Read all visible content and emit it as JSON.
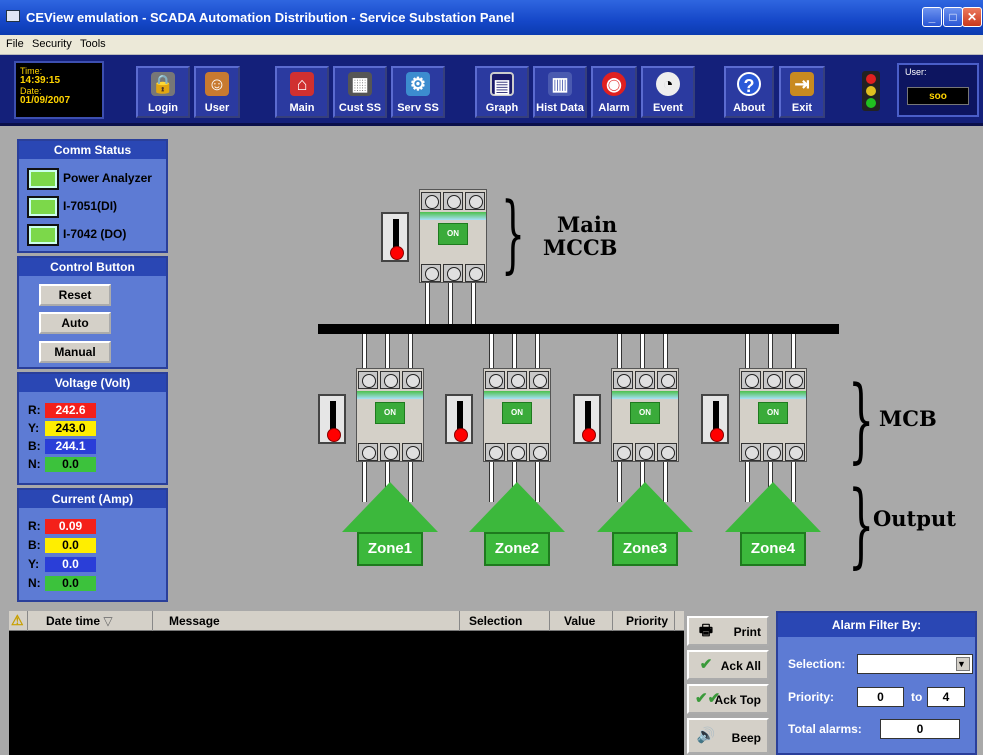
{
  "window": {
    "title": "CEView emulation - SCADA Automation Distribution - Service Substation Panel"
  },
  "menu": [
    "File",
    "Security",
    "Tools"
  ],
  "clock": {
    "time_label": "Time:",
    "time": "14:39:15",
    "date_label": "Date:",
    "date": "01/09/2007"
  },
  "toolbar": [
    {
      "label": "Login",
      "icon": "lock-icon"
    },
    {
      "label": "User",
      "icon": "users-icon"
    },
    {
      "label": "Main",
      "icon": "home-icon"
    },
    {
      "label": "Cust SS",
      "icon": "chip-icon"
    },
    {
      "label": "Serv SS",
      "icon": "network-icon"
    },
    {
      "label": "Graph",
      "icon": "monitor-icon"
    },
    {
      "label": "Hist Data",
      "icon": "folder-icon"
    },
    {
      "label": "Alarm",
      "icon": "alarm-icon"
    },
    {
      "label": "Event",
      "icon": "gauge-icon"
    },
    {
      "label": "About",
      "icon": "question-icon"
    },
    {
      "label": "Exit",
      "icon": "door-icon"
    }
  ],
  "user": {
    "label": "User:",
    "name": "soo"
  },
  "comm_status": {
    "title": "Comm Status",
    "items": [
      "Power Analyzer",
      "I-7051(DI)",
      "I-7042 (DO)"
    ]
  },
  "control": {
    "title": "Control Button",
    "buttons": [
      "Reset",
      "Auto",
      "Manual"
    ]
  },
  "voltage": {
    "title": "Voltage (Volt)",
    "rows": [
      {
        "label": "R:",
        "value": "242.6",
        "color": "#f4201a"
      },
      {
        "label": "Y:",
        "value": "243.0",
        "color": "#ffee00"
      },
      {
        "label": "B:",
        "value": "244.1",
        "color": "#2a3ed8"
      },
      {
        "label": "N:",
        "value": "0.0",
        "color": "#3cc23c"
      }
    ]
  },
  "current": {
    "title": "Current (Amp)",
    "rows": [
      {
        "label": "R:",
        "value": "0.09",
        "color": "#f4201a"
      },
      {
        "label": "B:",
        "value": "0.0",
        "color": "#ffee00"
      },
      {
        "label": "Y:",
        "value": "0.0",
        "color": "#2a3ed8"
      },
      {
        "label": "N:",
        "value": "0.0",
        "color": "#3cc23c"
      }
    ]
  },
  "diagram": {
    "main_label_1": "Main",
    "main_label_2": "MCCB",
    "mcb_label": "MCB",
    "output_label": "Output",
    "breaker_state": "ON",
    "zones": [
      "Zone1",
      "Zone2",
      "Zone3",
      "Zone4"
    ]
  },
  "alarm_table": {
    "columns": [
      "Date time",
      "Message",
      "Selection",
      "Value",
      "Priority"
    ],
    "rows": []
  },
  "alarm_buttons": [
    "Print",
    "Ack All",
    "Ack Top",
    "Beep"
  ],
  "filter": {
    "title": "Alarm Filter By:",
    "selection_label": "Selection:",
    "selection_value": "",
    "priority_label": "Priority:",
    "priority_from": "0",
    "to_label": "to",
    "priority_to": "4",
    "total_label": "Total alarms:",
    "total": "0"
  }
}
